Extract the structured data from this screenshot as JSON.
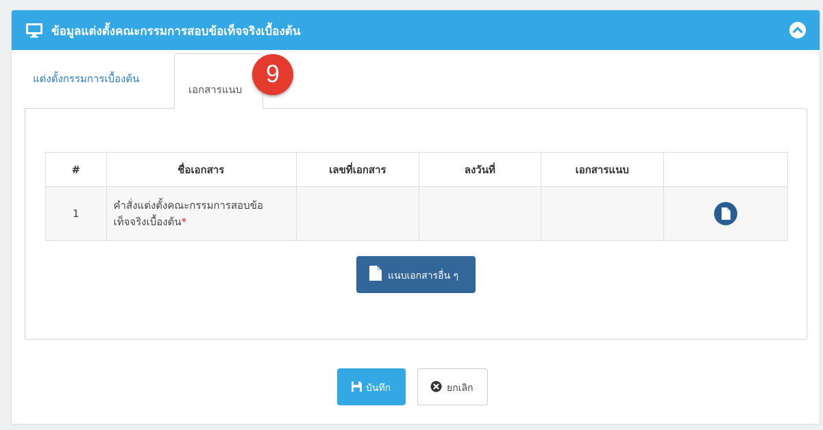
{
  "header": {
    "title": "ข้อมูลแต่งตั้งคณะกรรมการสอบข้อเท็จจริงเบื้องต้น"
  },
  "tabs": [
    {
      "label": "แต่งตั้งกรรมการเบื้องต้น"
    },
    {
      "label": "เอกสารแนบ"
    }
  ],
  "step_badge": "9",
  "table": {
    "columns": [
      "#",
      "ชื่อเอกสาร",
      "เลขที่เอกสาร",
      "ลงวันที่",
      "เอกสารแนบ",
      ""
    ],
    "rows": [
      {
        "num": "1",
        "name_line1": "คำสั่งแต่งตั้งคณะกรรมการสอบข้อ",
        "name_line2": "เท็จจริงเบื้องต้น",
        "required_mark": "*",
        "doc_no": "",
        "date": "",
        "attachment": ""
      }
    ]
  },
  "buttons": {
    "attach_other": "แนบเอกสารอื่น ๆ",
    "save": "บันทึก",
    "cancel": "ยกเลิก"
  },
  "colors": {
    "header_bg": "#34a8e4",
    "primary_dark": "#336699",
    "badge": "#e53b2f",
    "required": "#e0242b"
  },
  "icons": {
    "header": "monitor-icon",
    "collapse": "chevron-up-icon",
    "row_action": "file-icon",
    "attach_other": "file-icon",
    "save": "floppy-disk-icon",
    "cancel": "times-circle-icon"
  }
}
